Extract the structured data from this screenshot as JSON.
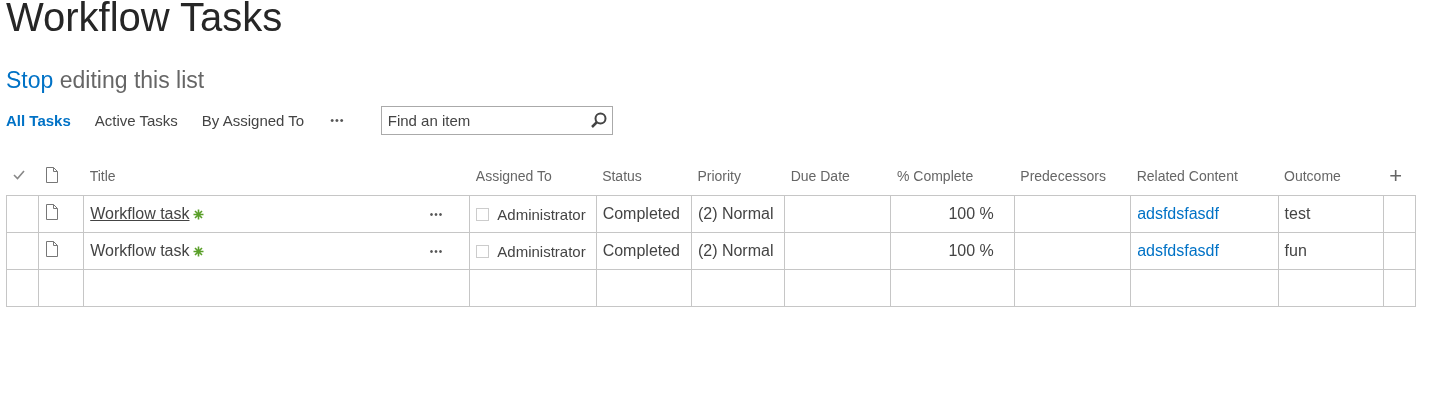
{
  "page_title": "Workflow Tasks",
  "edit_link": {
    "link": "Stop",
    "text": "editing this list"
  },
  "views": [
    {
      "label": "All Tasks",
      "selected": true
    },
    {
      "label": "Active Tasks",
      "selected": false
    },
    {
      "label": "By Assigned To",
      "selected": false
    }
  ],
  "views_more": "•••",
  "search": {
    "placeholder": "Find an item"
  },
  "table": {
    "columns": [
      "Title",
      "Assigned To",
      "Status",
      "Priority",
      "Due Date",
      "% Complete",
      "Predecessors",
      "Related Content",
      "Outcome"
    ],
    "add_column": "+",
    "rows": [
      {
        "title": "Workflow task",
        "hovered": true,
        "menu": "•••",
        "assigned_to": "Administrator",
        "assigned_checked": false,
        "status": "Completed",
        "priority": "(2) Normal",
        "percent_complete": "100 %",
        "related_content": "adsfdsfasdf",
        "outcome": "test"
      },
      {
        "title": "Workflow task",
        "hovered": false,
        "menu": "•••",
        "assigned_to": "Administrator",
        "assigned_checked": false,
        "status": "Completed",
        "priority": "(2) Normal",
        "percent_complete": "100 %",
        "related_content": "adsfdsfasdf",
        "outcome": "fun"
      }
    ]
  }
}
